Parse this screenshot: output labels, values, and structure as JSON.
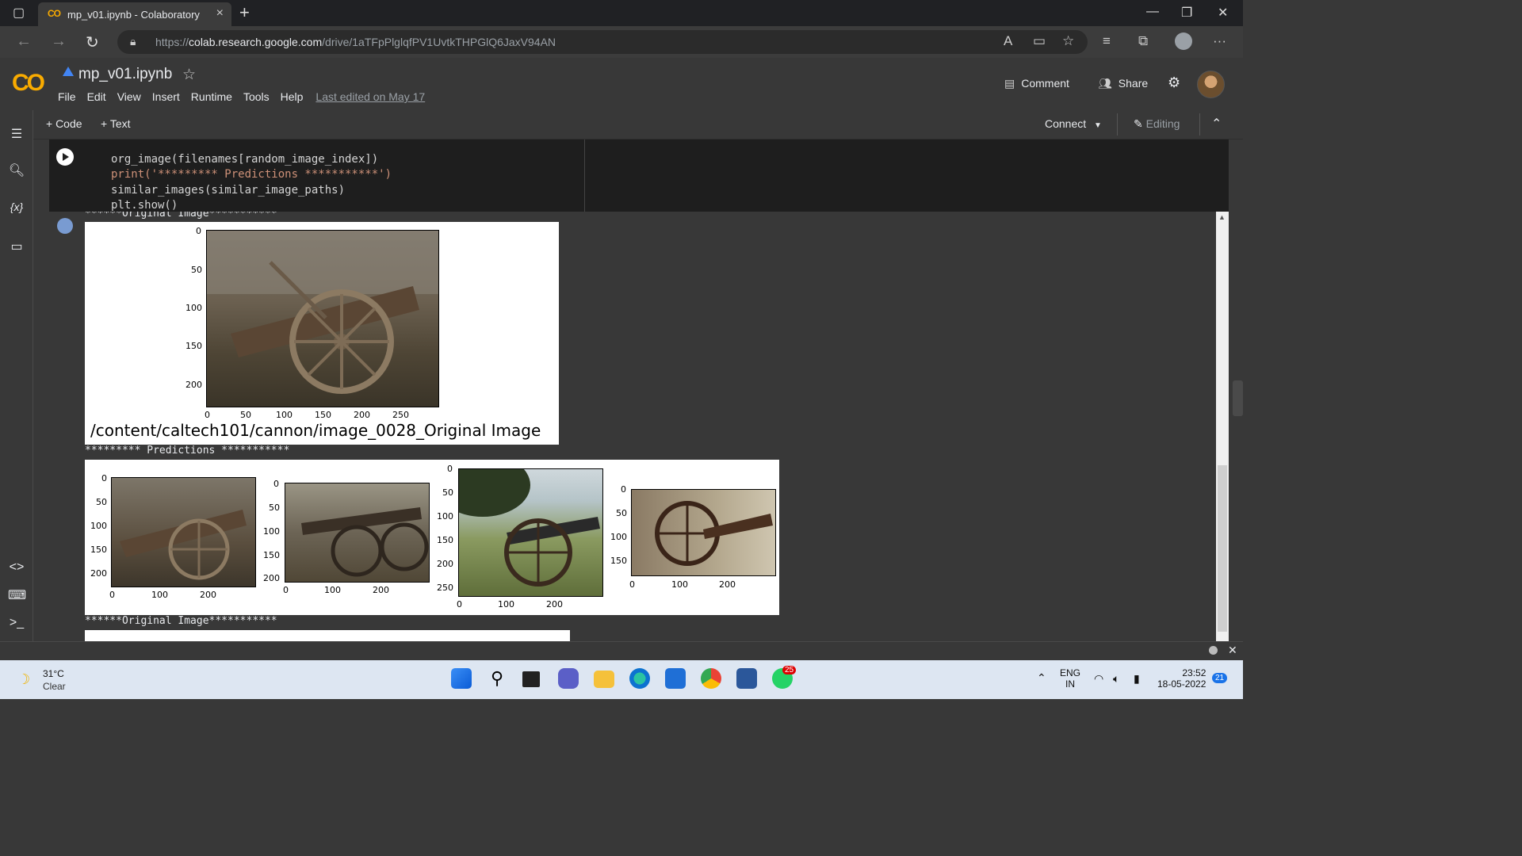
{
  "browser": {
    "tab_title": "mp_v01.ipynb - Colaboratory",
    "url_prefix": "https://",
    "url_host": "colab.research.google.com",
    "url_path": "/drive/1aTFpPlglqfPV1UvtkTHPGlQ6JaxV94AN"
  },
  "colab": {
    "logo": "CO",
    "notebook_name": "mp_v01.ipynb",
    "menu": [
      "File",
      "Edit",
      "View",
      "Insert",
      "Runtime",
      "Tools",
      "Help"
    ],
    "last_edited": "Last edited on May 17",
    "comment_label": "Comment",
    "share_label": "Share"
  },
  "toolbar": {
    "code_label": "+ Code",
    "text_label": "+ Text",
    "connect_label": "Connect",
    "editing_label": "Editing"
  },
  "cell": {
    "lines": [
      "org_image(filenames[random_image_index])",
      "print('********* Predictions ***********')",
      "similar_images(similar_image_paths)",
      "plt.show()"
    ]
  },
  "output": {
    "header_original_1": "******Original Image***********",
    "caption_1": "/content/caltech101/cannon/image_0028_Original Image",
    "predictions_header": "********* Predictions ***********",
    "header_original_2": "******Original Image***********",
    "fig1_yticks": [
      "0",
      "50",
      "100",
      "150",
      "200"
    ],
    "fig1_xticks": [
      "0",
      "50",
      "100",
      "150",
      "200",
      "250"
    ],
    "pred1_yticks": [
      "0",
      "50",
      "100",
      "150",
      "200"
    ],
    "pred1_xticks": [
      "0",
      "100",
      "200"
    ],
    "pred2_yticks": [
      "0",
      "50",
      "100",
      "150",
      "200"
    ],
    "pred2_xticks": [
      "0",
      "100",
      "200"
    ],
    "pred3_yticks": [
      "0",
      "50",
      "100",
      "150",
      "200",
      "250"
    ],
    "pred3_xticks": [
      "0",
      "100",
      "200"
    ],
    "pred4_yticks": [
      "0",
      "50",
      "100",
      "150"
    ],
    "pred4_xticks": [
      "0",
      "100",
      "200"
    ]
  },
  "taskbar": {
    "temperature": "31°C",
    "condition": "Clear",
    "language": "ENG",
    "region": "IN",
    "time": "23:52",
    "date": "18-05-2022",
    "notification_count": "21",
    "whatsapp_badge": "25"
  }
}
